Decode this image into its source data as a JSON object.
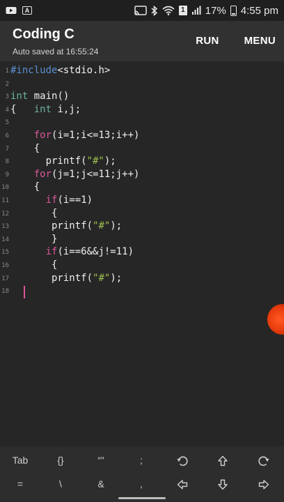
{
  "status_bar": {
    "left_icons": [
      "video-icon",
      "a-icon"
    ],
    "right_icons": [
      "cast-icon",
      "bluetooth-icon",
      "wifi-icon",
      "sim-icon",
      "signal-icon"
    ],
    "sim_label": "1",
    "battery": "17%",
    "time": "4:55 pm"
  },
  "app_bar": {
    "title": "Coding C",
    "subtitle": "Auto saved at 16:55:24",
    "run_label": "RUN",
    "menu_label": "MENU"
  },
  "editor": {
    "line_numbers": [
      "1",
      "2",
      "3",
      "4",
      "5",
      "6",
      "7",
      "8",
      "9",
      "10",
      "11",
      "12",
      "13",
      "14",
      "15",
      "16",
      "17",
      "18"
    ],
    "lines": [
      [
        {
          "t": "#include",
          "c": "pp"
        },
        {
          "t": "<stdio.h>",
          "c": ""
        }
      ],
      [],
      [
        {
          "t": "int",
          "c": "ty"
        },
        {
          "t": " main()",
          "c": ""
        }
      ],
      [
        {
          "t": "{   ",
          "c": ""
        },
        {
          "t": "int",
          "c": "ty"
        },
        {
          "t": " i,j;",
          "c": ""
        }
      ],
      [],
      [
        {
          "t": "    ",
          "c": ""
        },
        {
          "t": "for",
          "c": "kw"
        },
        {
          "t": "(i=1;i<=13;i++)",
          "c": ""
        }
      ],
      [
        {
          "t": "    {",
          "c": ""
        }
      ],
      [
        {
          "t": "      printf(",
          "c": ""
        },
        {
          "t": "\"#\"",
          "c": "st"
        },
        {
          "t": ");",
          "c": ""
        }
      ],
      [
        {
          "t": "    ",
          "c": ""
        },
        {
          "t": "for",
          "c": "kw"
        },
        {
          "t": "(j=1;j<=11;j++)",
          "c": ""
        }
      ],
      [
        {
          "t": "    {",
          "c": ""
        }
      ],
      [
        {
          "t": "      ",
          "c": ""
        },
        {
          "t": "if",
          "c": "kw"
        },
        {
          "t": "(i==1)",
          "c": ""
        }
      ],
      [
        {
          "t": "       {",
          "c": ""
        }
      ],
      [
        {
          "t": "       printf(",
          "c": ""
        },
        {
          "t": "\"#\"",
          "c": "st"
        },
        {
          "t": ");",
          "c": ""
        }
      ],
      [
        {
          "t": "       }",
          "c": ""
        }
      ],
      [
        {
          "t": "      ",
          "c": ""
        },
        {
          "t": "if",
          "c": "kw"
        },
        {
          "t": "(i==6&&j!=11)",
          "c": ""
        }
      ],
      [
        {
          "t": "       {",
          "c": ""
        }
      ],
      [
        {
          "t": "       printf(",
          "c": ""
        },
        {
          "t": "\"#\"",
          "c": "st"
        },
        {
          "t": ");",
          "c": ""
        }
      ],
      []
    ]
  },
  "keyboard": {
    "row1": [
      "Tab",
      "{}",
      "“”",
      ";",
      "undo-icon",
      "arrow-up-icon",
      "redo-icon"
    ],
    "row2": [
      "=",
      "\\",
      "&",
      ",",
      "arrow-left-icon",
      "arrow-down-icon",
      "arrow-right-icon"
    ]
  }
}
